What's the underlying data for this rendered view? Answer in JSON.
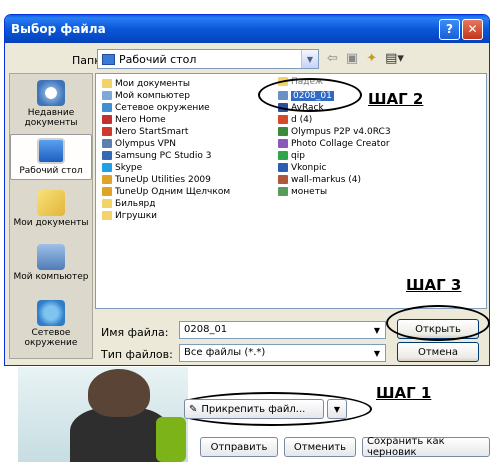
{
  "dialog": {
    "title": "Выбор файла",
    "help_label": "?",
    "close_label": "✕",
    "folder_label": "Папка:",
    "folder_value": "Рабочий стол"
  },
  "places": [
    {
      "label": "Недавние документы",
      "icon": "recent-documents-icon"
    },
    {
      "label": "Рабочий стол",
      "icon": "desktop-icon"
    },
    {
      "label": "Мои документы",
      "icon": "my-documents-icon"
    },
    {
      "label": "Мой компьютер",
      "icon": "my-computer-icon"
    },
    {
      "label": "Сетевое окружение",
      "icon": "network-icon"
    }
  ],
  "files_left": [
    {
      "label": "Мои документы",
      "icon": "folder-icon"
    },
    {
      "label": "Мой компьютер",
      "icon": "computer-icon"
    },
    {
      "label": "Сетевое окружение",
      "icon": "network-icon"
    },
    {
      "label": "Nero Home",
      "icon": "app-icon"
    },
    {
      "label": "Nero StartSmart",
      "icon": "app-icon"
    },
    {
      "label": "Olympus VPN",
      "icon": "shortcut-icon"
    },
    {
      "label": "Samsung PC Studio 3",
      "icon": "app-icon"
    },
    {
      "label": "Skype",
      "icon": "app-icon"
    },
    {
      "label": "TuneUp Utilities 2009",
      "icon": "app-icon"
    },
    {
      "label": "TuneUp Одним Щелчком",
      "icon": "app-icon"
    },
    {
      "label": "Бильярд",
      "icon": "folder-icon"
    },
    {
      "label": "Игрушки",
      "icon": "folder-icon"
    }
  ],
  "files_right": [
    {
      "label": "Падеж",
      "icon": "folder-icon"
    },
    {
      "label": "0208_01",
      "icon": "image-icon"
    },
    {
      "label": "AvRack",
      "icon": "app-icon"
    },
    {
      "label": "d (4)",
      "icon": "document-icon"
    },
    {
      "label": "Olympus P2P v4.0RC3",
      "icon": "app-icon"
    },
    {
      "label": "Photo Collage Creator",
      "icon": "app-icon"
    },
    {
      "label": "qip",
      "icon": "app-icon"
    },
    {
      "label": "Vkonpic",
      "icon": "app-icon"
    },
    {
      "label": "wall-markus (4)",
      "icon": "image-icon"
    },
    {
      "label": "монеты",
      "icon": "image-icon"
    }
  ],
  "fields": {
    "name_label": "Имя файла:",
    "name_value": "0208_01",
    "type_label": "Тип файлов:",
    "type_value": "Все файлы (*.*)",
    "open_label": "Открыть",
    "cancel_label": "Отмена"
  },
  "steps": {
    "step1": "ШАГ 1",
    "step2": "ШАГ 2",
    "step3": "ШАГ 3"
  },
  "page": {
    "attach_label": "Прикрепить файл...",
    "send_label": "Отправить",
    "cancel_label": "Отменить",
    "draft_label": "Сохранить как черновик"
  },
  "colors": {
    "titlebar": "#0a58d8",
    "selection": "#316ac5",
    "dialog_bg": "#ece9d8"
  }
}
